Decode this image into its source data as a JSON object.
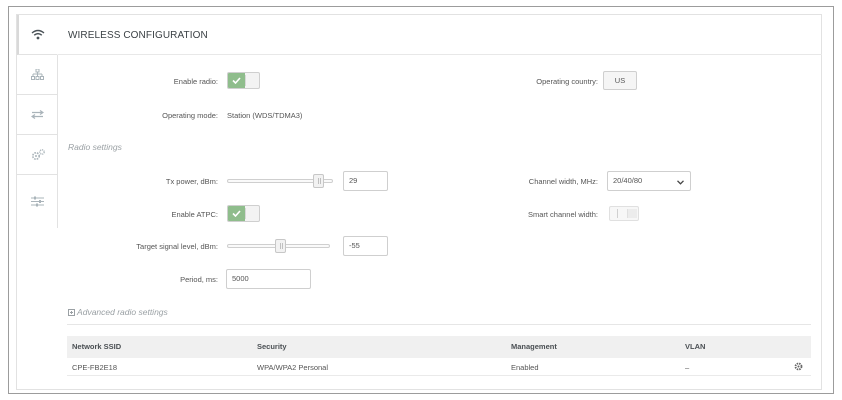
{
  "header": {
    "title": "WIRELESS CONFIGURATION"
  },
  "sidebar": {
    "items": [
      {
        "name": "wifi-icon",
        "active": true
      },
      {
        "name": "network-icon",
        "active": false
      },
      {
        "name": "transfer-icon",
        "active": false
      },
      {
        "name": "gears-icon",
        "active": false
      },
      {
        "name": "sliders-icon",
        "active": false
      }
    ]
  },
  "general": {
    "enable_radio_label": "Enable radio:",
    "enable_radio_on": true,
    "operating_country_label": "Operating country:",
    "operating_country_value": "US",
    "operating_mode_label": "Operating mode:",
    "operating_mode_value": "Station (WDS/TDMA3)"
  },
  "radio": {
    "section_title": "Radio settings",
    "tx_power_label": "Tx power, dBm:",
    "tx_power_value": "29",
    "tx_power_level": 0.9,
    "channel_width_label": "Channel width, MHz:",
    "channel_width_value": "20/40/80",
    "enable_atpc_label": "Enable ATPC:",
    "enable_atpc_on": true,
    "smart_channel_label": "Smart channel width:",
    "smart_channel_on": false,
    "target_signal_label": "Target signal level, dBm:",
    "target_signal_value": "-55",
    "target_signal_level": 0.52,
    "period_label": "Period, ms:",
    "period_value": "5000",
    "advanced_label": "Advanced radio settings",
    "advanced_icon": "plus-square-icon"
  },
  "table": {
    "headers": [
      "Network SSID",
      "Security",
      "Management",
      "VLAN"
    ],
    "rows": [
      [
        "CPE-FB2E18",
        "WPA/WPA2 Personal",
        "Enabled",
        "–"
      ]
    ]
  },
  "colors": {
    "toggle_on": "#8fbd8c",
    "header_bg": "#f0f0f0"
  }
}
